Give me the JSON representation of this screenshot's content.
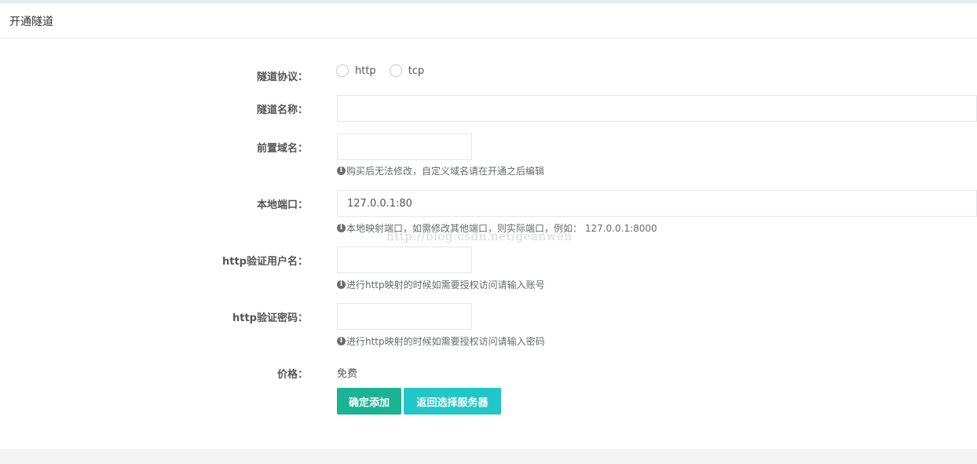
{
  "header": {
    "title": "开通隧道"
  },
  "form": {
    "protocol": {
      "label": "隧道协议：",
      "options": [
        "http",
        "tcp"
      ]
    },
    "name": {
      "label": "隧道名称：",
      "value": ""
    },
    "domain": {
      "label": "前置域名：",
      "value": "",
      "help": "购买后无法修改，自定义域名请在开通之后编辑"
    },
    "local_port": {
      "label": "本地端口：",
      "value": "127.0.0.1:80",
      "help": "本地映射端口，如需修改其他端口，则实际端口，例如： 127.0.0.1:8000"
    },
    "http_user": {
      "label": "http验证用户名：",
      "value": "",
      "help": "进行http映射的时候如需要授权访问请输入账号"
    },
    "http_pass": {
      "label": "http验证密码：",
      "value": "",
      "help": "进行http映射的时候如需要授权访问请输入密码"
    },
    "price": {
      "label": "价格：",
      "value": "免费"
    }
  },
  "buttons": {
    "confirm": "确定添加",
    "back": "返回选择服务器"
  },
  "watermark": "http://blog.csdn.net/geanwen",
  "colors": {
    "primary": "#1ab394",
    "info": "#23c6c8"
  }
}
